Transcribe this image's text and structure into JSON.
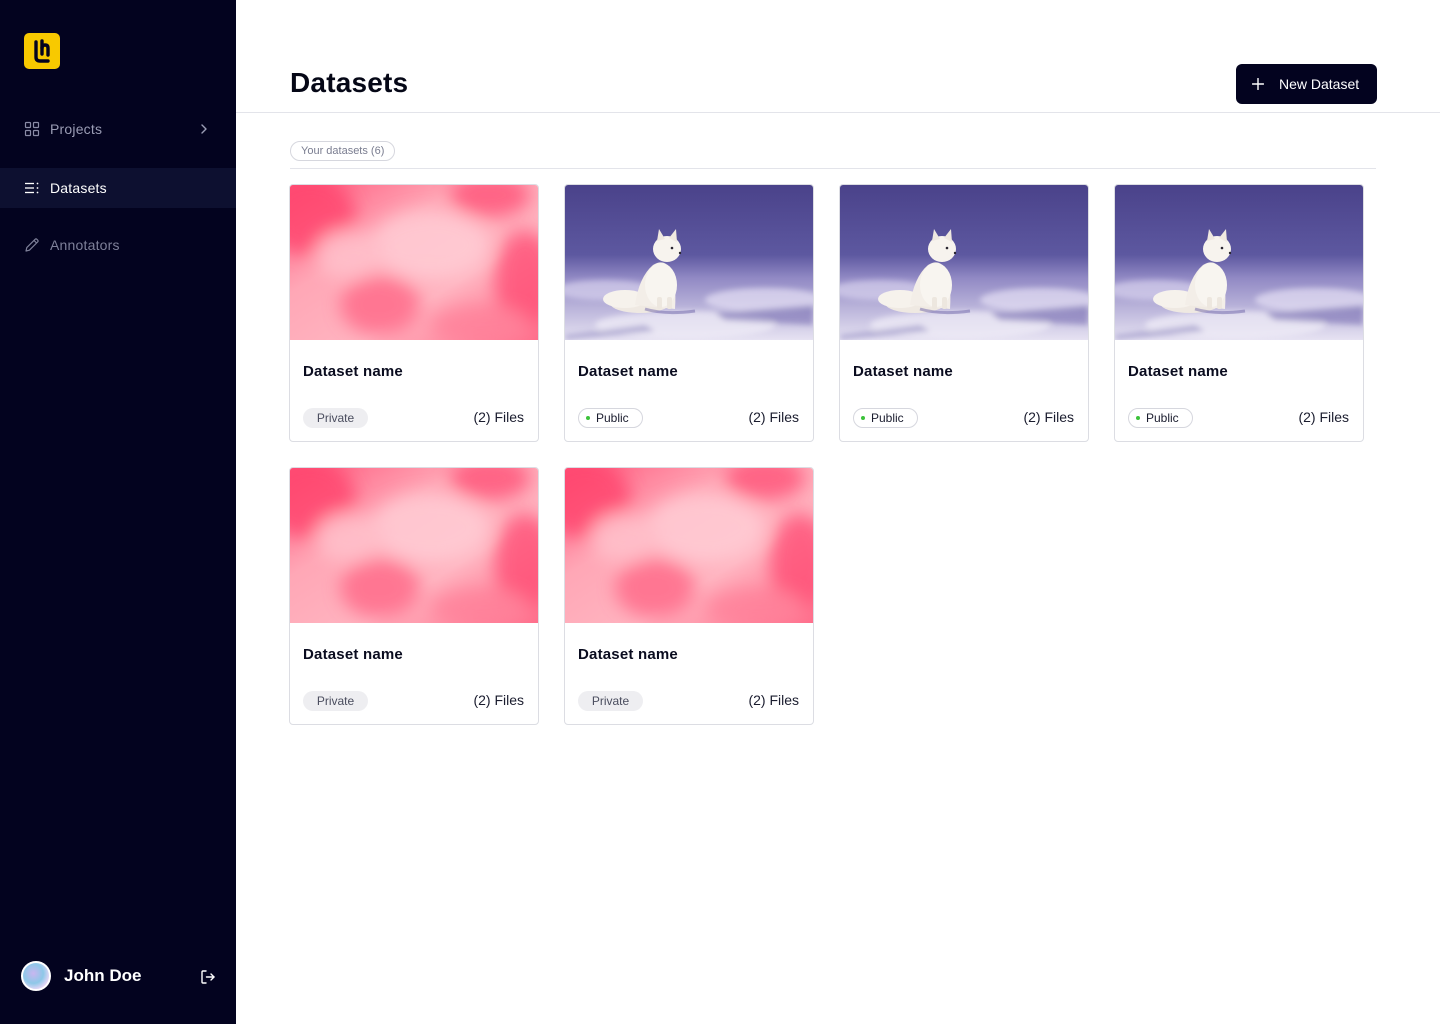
{
  "sidebar": {
    "nav": [
      {
        "label": "Projects",
        "icon": "grid-icon",
        "has_chevron": true
      },
      {
        "label": "Datasets",
        "icon": "list-icon",
        "active": true
      },
      {
        "label": "Annotators",
        "icon": "pencil-icon"
      }
    ],
    "user": {
      "name": "John Doe"
    }
  },
  "header": {
    "title": "Datasets",
    "new_button_label": "New Dataset"
  },
  "tabs": {
    "your_datasets": "Your datasets (6)"
  },
  "datasets": [
    {
      "name": "Dataset name",
      "visibility": "Private",
      "files": "(2) Files",
      "thumbnail": "pink-clouds"
    },
    {
      "name": "Dataset name",
      "visibility": "Public",
      "files": "(2) Files",
      "thumbnail": "arctic-fox"
    },
    {
      "name": "Dataset name",
      "visibility": "Public",
      "files": "(2) Files",
      "thumbnail": "arctic-fox"
    },
    {
      "name": "Dataset name",
      "visibility": "Public",
      "files": "(2) Files",
      "thumbnail": "arctic-fox"
    },
    {
      "name": "Dataset name",
      "visibility": "Private",
      "files": "(2) Files",
      "thumbnail": "pink-clouds"
    },
    {
      "name": "Dataset name",
      "visibility": "Private",
      "files": "(2) Files",
      "thumbnail": "pink-clouds"
    }
  ],
  "colors": {
    "sidebar_bg": "#03031f",
    "accent_logo": "#f8c900",
    "public_dot": "#3cc23a"
  }
}
